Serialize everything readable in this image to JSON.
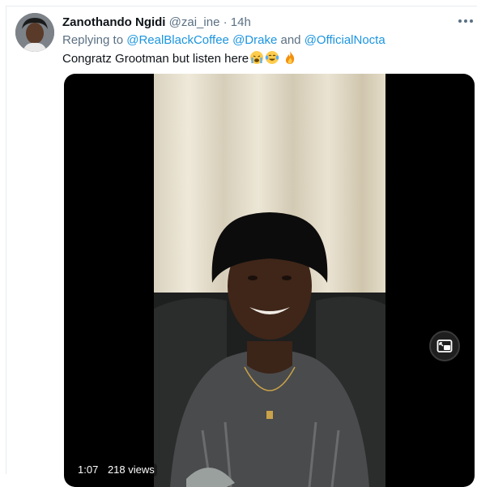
{
  "tweet": {
    "author_name": "Zanothando Ngidi",
    "handle": "@zai_ine",
    "separator": "·",
    "time": "14h",
    "reply_prefix": "Replying to",
    "mentions": [
      "@RealBlackCoffee",
      "@Drake",
      "@OfficialNocta"
    ],
    "mention_joiner": "and",
    "text": "Congratz Grootman but listen here",
    "emojis": [
      "loudly-crying-face",
      "face-with-tears-of-joy",
      "fire"
    ]
  },
  "video": {
    "elapsed": "1:07",
    "views": "218 views",
    "pip_icon": "picture-in-picture-icon"
  },
  "colors": {
    "name": "#0f1419",
    "secondary": "#5b7083",
    "link": "#1b95e0",
    "media_bg": "#000000"
  }
}
